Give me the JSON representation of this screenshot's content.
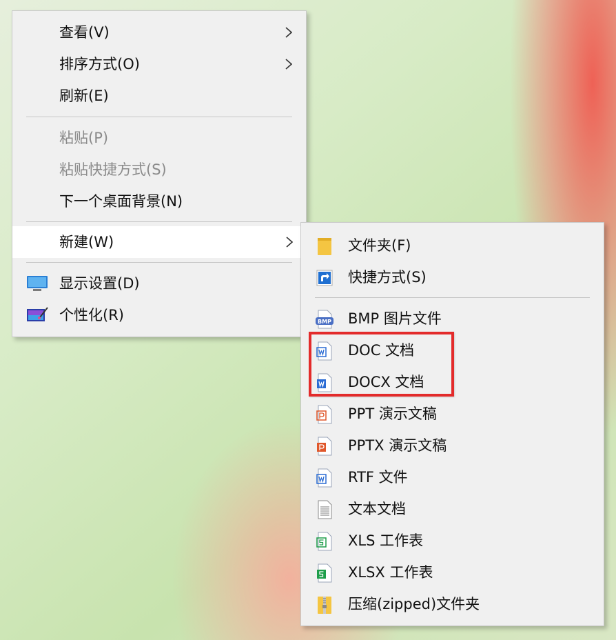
{
  "main_menu": {
    "items": [
      {
        "label": "查看(V)"
      },
      {
        "label": "排序方式(O)"
      },
      {
        "label": "刷新(E)"
      },
      {
        "label": "粘贴(P)"
      },
      {
        "label": "粘贴快捷方式(S)"
      },
      {
        "label": "下一个桌面背景(N)"
      },
      {
        "label": "新建(W)"
      },
      {
        "label": "显示设置(D)"
      },
      {
        "label": "个性化(R)"
      }
    ]
  },
  "sub_menu": {
    "items": [
      {
        "label": "文件夹(F)",
        "icon": "folder-icon"
      },
      {
        "label": "快捷方式(S)",
        "icon": "shortcut-icon"
      },
      {
        "label": "BMP 图片文件",
        "icon": "bmp-file-icon"
      },
      {
        "label": "DOC 文档",
        "icon": "doc-file-icon"
      },
      {
        "label": "DOCX 文档",
        "icon": "docx-file-icon"
      },
      {
        "label": "PPT 演示文稿",
        "icon": "ppt-file-icon"
      },
      {
        "label": "PPTX 演示文稿",
        "icon": "pptx-file-icon"
      },
      {
        "label": "RTF 文件",
        "icon": "rtf-file-icon"
      },
      {
        "label": "文本文档",
        "icon": "text-file-icon"
      },
      {
        "label": "XLS 工作表",
        "icon": "xls-file-icon"
      },
      {
        "label": "XLSX 工作表",
        "icon": "xlsx-file-icon"
      },
      {
        "label": "压缩(zipped)文件夹",
        "icon": "zip-folder-icon"
      }
    ]
  },
  "colors": {
    "menu_bg": "#f0f0f0",
    "highlight": "#ffffff",
    "disabled_text": "#8a8a8a",
    "annotation_box": "#e32b2b",
    "word_blue": "#2b6cd4",
    "ppt_orange": "#e0572b",
    "excel_green": "#1e9e4a"
  }
}
